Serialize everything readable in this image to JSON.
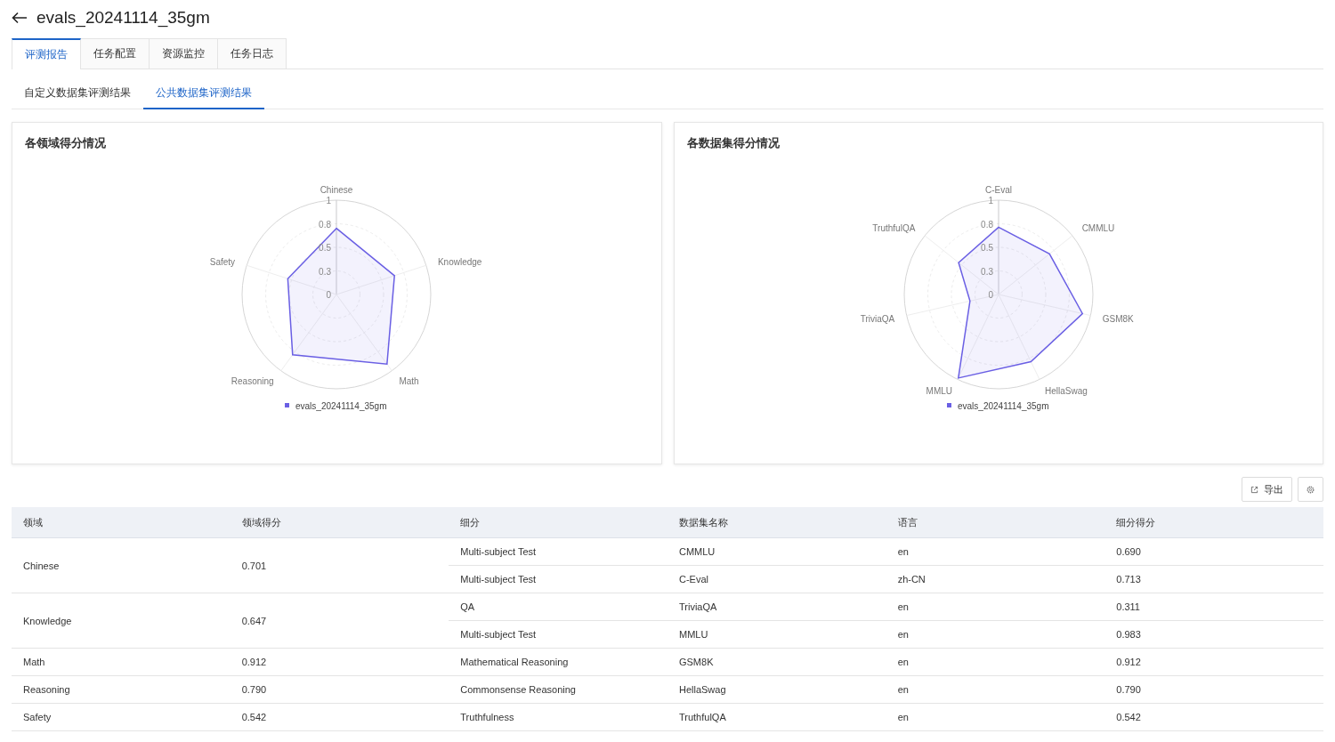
{
  "header": {
    "title": "evals_20241114_35gm"
  },
  "tabs": [
    {
      "label": "评测报告",
      "selected": true
    },
    {
      "label": "任务配置",
      "selected": false
    },
    {
      "label": "资源监控",
      "selected": false
    },
    {
      "label": "任务日志",
      "selected": false
    }
  ],
  "subtabs": [
    {
      "label": "自定义数据集评测结果",
      "selected": false
    },
    {
      "label": "公共数据集评测结果",
      "selected": true
    }
  ],
  "charts": [
    {
      "title": "各领域得分情况",
      "chart_data": {
        "type": "radar",
        "categories": [
          "Chinese",
          "Knowledge",
          "Math",
          "Reasoning",
          "Safety"
        ],
        "ylim": [
          0,
          1
        ],
        "yticks": [
          {
            "value": 0,
            "label": "0"
          },
          {
            "value": 0.25,
            "label": "0.3"
          },
          {
            "value": 0.5,
            "label": "0.5"
          },
          {
            "value": 0.75,
            "label": "0.8"
          },
          {
            "value": 1,
            "label": "1"
          }
        ],
        "series": [
          {
            "name": "evals_20241114_35gm",
            "color": "#6a5fe4",
            "values": [
              0.701,
              0.647,
              0.912,
              0.79,
              0.542
            ]
          }
        ]
      }
    },
    {
      "title": "各数据集得分情况",
      "chart_data": {
        "type": "radar",
        "categories": [
          "C-Eval",
          "CMMLU",
          "GSM8K",
          "HellaSwag",
          "MMLU",
          "TriviaQA",
          "TruthfulQA"
        ],
        "ylim": [
          0,
          1
        ],
        "yticks": [
          {
            "value": 0,
            "label": "0"
          },
          {
            "value": 0.25,
            "label": "0.3"
          },
          {
            "value": 0.5,
            "label": "0.5"
          },
          {
            "value": 0.75,
            "label": "0.8"
          },
          {
            "value": 1,
            "label": "1"
          }
        ],
        "series": [
          {
            "name": "evals_20241114_35gm",
            "color": "#6a5fe4",
            "values": [
              0.713,
              0.69,
              0.912,
              0.79,
              0.983,
              0.311,
              0.542
            ]
          }
        ]
      }
    }
  ],
  "toolbar": {
    "export_label": "导出"
  },
  "table": {
    "columns": [
      "领域",
      "领域得分",
      "细分",
      "数据集名称",
      "语言",
      "细分得分"
    ],
    "rows": [
      {
        "domain": "Chinese",
        "score": "0.701",
        "items": [
          {
            "subdomain": "Multi-subject Test",
            "dataset": "CMMLU",
            "language": "en",
            "score": "0.690"
          },
          {
            "subdomain": "Multi-subject Test",
            "dataset": "C-Eval",
            "language": "zh-CN",
            "score": "0.713"
          }
        ]
      },
      {
        "domain": "Knowledge",
        "score": "0.647",
        "items": [
          {
            "subdomain": "QA",
            "dataset": "TriviaQA",
            "language": "en",
            "score": "0.311"
          },
          {
            "subdomain": "Multi-subject Test",
            "dataset": "MMLU",
            "language": "en",
            "score": "0.983"
          }
        ]
      },
      {
        "domain": "Math",
        "score": "0.912",
        "items": [
          {
            "subdomain": "Mathematical Reasoning",
            "dataset": "GSM8K",
            "language": "en",
            "score": "0.912"
          }
        ]
      },
      {
        "domain": "Reasoning",
        "score": "0.790",
        "items": [
          {
            "subdomain": "Commonsense Reasoning",
            "dataset": "HellaSwag",
            "language": "en",
            "score": "0.790"
          }
        ]
      },
      {
        "domain": "Safety",
        "score": "0.542",
        "items": [
          {
            "subdomain": "Truthfulness",
            "dataset": "TruthfulQA",
            "language": "en",
            "score": "0.542"
          }
        ]
      }
    ]
  }
}
